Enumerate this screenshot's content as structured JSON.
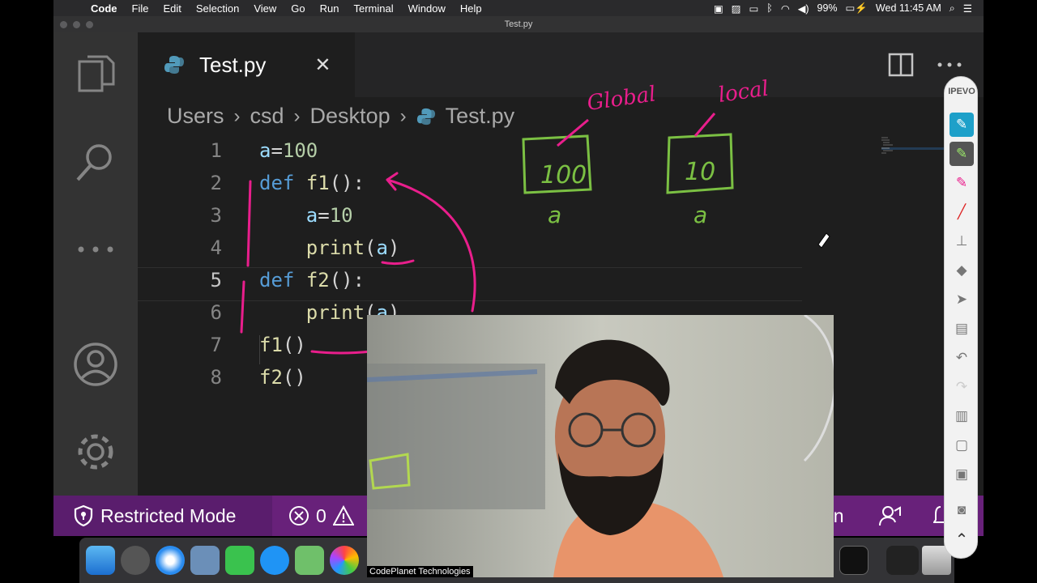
{
  "menubar": {
    "app": "Code",
    "items": [
      "File",
      "Edit",
      "Selection",
      "View",
      "Go",
      "Run",
      "Terminal",
      "Window",
      "Help"
    ],
    "battery": "99%",
    "clock": "Wed 11:45 AM"
  },
  "window": {
    "title": "Test.py"
  },
  "tab": {
    "label": "Test.py",
    "close_glyph": "✕"
  },
  "breadcrumb": [
    "Users",
    "csd",
    "Desktop",
    "Test.py"
  ],
  "editor": {
    "line_numbers": [
      "1",
      "2",
      "3",
      "4",
      "5",
      "6",
      "7",
      "8"
    ],
    "active_line": "5"
  },
  "annotations": {
    "global_label": "Global",
    "local_label": "local",
    "box1_value": "100",
    "box2_value": "10",
    "var1": "a",
    "var2": "a"
  },
  "statusbar": {
    "restricted": "Restricted Mode",
    "errors": "0",
    "right_partial": "on"
  },
  "ipevo": {
    "brand": "IPEVO"
  },
  "webcam": {
    "caption": "CodePlanet Technologies"
  },
  "colors": {
    "status_bar": "#68217a",
    "annotation_pink": "#e91e8c",
    "annotation_green": "#7bc043",
    "keyword": "#569cd6",
    "function": "#dcdcaa",
    "number": "#b5cea8"
  }
}
